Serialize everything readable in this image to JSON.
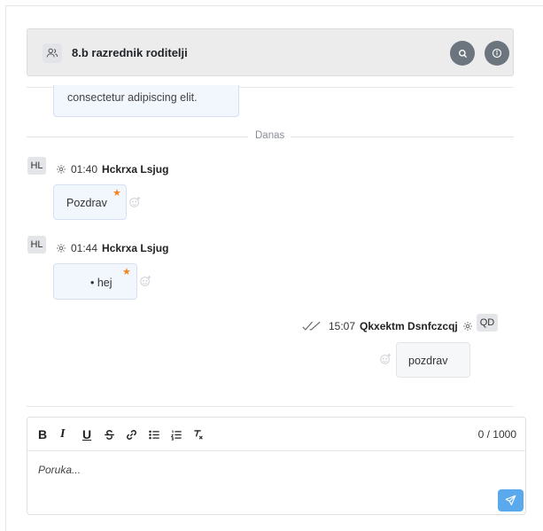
{
  "chat": {
    "title": "8.b razrednik roditelji",
    "icons": {
      "group": "users-icon",
      "search": "search-icon",
      "info": "info-icon"
    }
  },
  "messages": {
    "partial_text": "consectetur adipiscing elit.",
    "date_divider": "Danas",
    "items": [
      {
        "initials": "HL",
        "time": "01:40",
        "author": "Hckrxa Lsjug",
        "text": "Pozdrav",
        "starred": true
      },
      {
        "initials": "HL",
        "time": "01:44",
        "author": "Hckrxa Lsjug",
        "text": "• hej",
        "starred": true
      },
      {
        "initials": "QD",
        "time": "15:07",
        "author": "Qkxektm Dsnfczcqj",
        "text": "pozdrav",
        "read": true
      }
    ]
  },
  "composer": {
    "toolbar": {
      "bold": "B",
      "italic": "I",
      "underline": "U",
      "icons": [
        "bold-icon",
        "italic-icon",
        "underline-icon",
        "strikethrough-icon",
        "link-icon",
        "bullet-list-icon",
        "numbered-list-icon",
        "clear-format-icon"
      ]
    },
    "counter": "0 / 1000",
    "placeholder": "Poruka...",
    "colors": {
      "send": "#5aa9ec",
      "accent_star": "#f5841f"
    }
  }
}
